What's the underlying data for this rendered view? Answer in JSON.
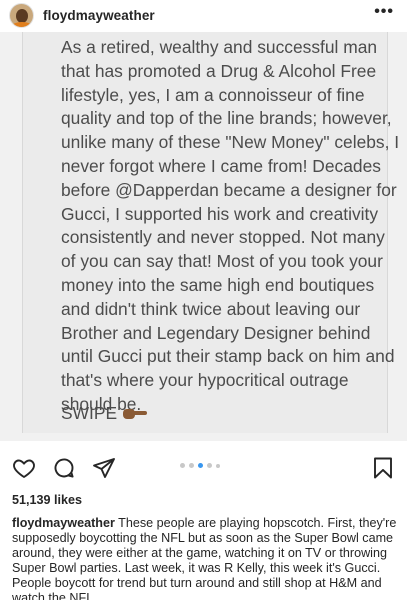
{
  "post": {
    "username": "floydmayweather",
    "more_label": "•••",
    "image_text": "As a retired, wealthy and successful man that has promoted a Drug & Alcohol Free lifestyle, yes, I am a connoisseur of fine quality and top of the line brands; however, unlike many of these \"New Money\" celebs, I never forgot where I came from!  Decades before @Dapperdan became a designer for Gucci, I supported his work and creativity consistently and never stopped. Not many of you can say that!  Most of you took your money into the same high end boutiques and didn't think twice about leaving our Brother and Legendary Designer behind until Gucci put their stamp back on him and that's where your hypocritical outrage should be.",
    "swipe_label": "SWIPE",
    "likes": "51,139 likes",
    "caption_user": "floydmayweather",
    "caption_text": " These people are playing hopscotch. First, they're supposedly boycotting the NFL but as soon as the Super Bowl came around, they were either at the game, watching it on TV or throwing Super Bowl parties. Last week, it was R Kelly, this week it's Gucci. People boycott for trend but turn around and still shop at H&M and watch the NFL."
  },
  "icons": {
    "like": "heart-icon",
    "comment": "comment-icon",
    "share": "share-icon",
    "save": "bookmark-icon",
    "swipe": "pointing-hand-icon"
  },
  "carousel": {
    "total": 5,
    "active": 3
  },
  "colors": {
    "accent": "#3897f0",
    "text": "#262626",
    "image_text": "#4c4c4c"
  }
}
